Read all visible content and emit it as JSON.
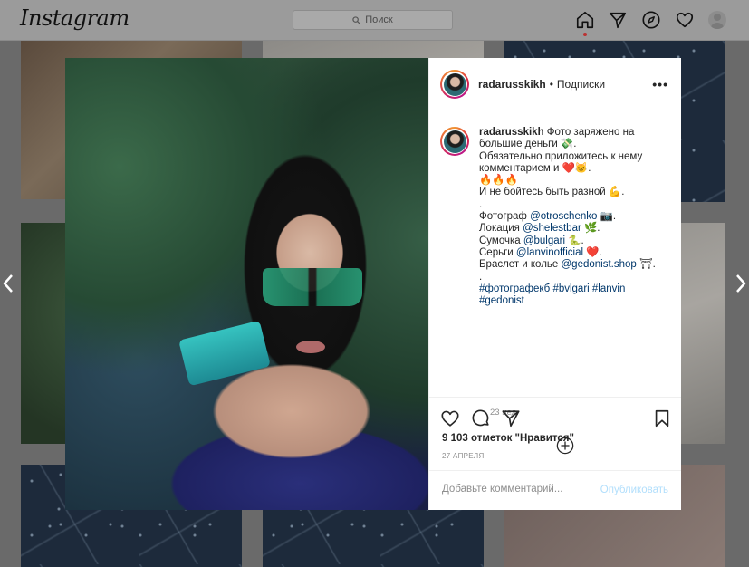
{
  "topbar": {
    "logo": "Instagram",
    "search_placeholder": "Поиск",
    "icons": [
      "home-icon",
      "direct-icon",
      "explore-icon",
      "activity-icon",
      "profile-avatar"
    ]
  },
  "post": {
    "username": "radarusskikh",
    "separator": "•",
    "follow_status": "Подписки",
    "more": "•••",
    "caption": {
      "author": "radarusskikh",
      "line1_text": " Фото заряжено на",
      "line2": "большие деньги 💸.",
      "line3": "Обязательно приложитесь к нему",
      "line4": "комментарием и ❤️🐱.",
      "line5": "🔥🔥🔥",
      "line6": "И не бойтесь быть разной 💪.",
      "line7": ".",
      "line8_prefix": "Фотограф ",
      "line8_tag": "@otroschenko",
      "line8_suffix": " 📷.",
      "line9_prefix": "Локация ",
      "line9_tag": "@shelestbar",
      "line9_suffix": " 🌿.",
      "line10_prefix": "Сумочка ",
      "line10_tag": "@bulgari",
      "line10_suffix": " 🐍.",
      "line11_prefix": "Серьги ",
      "line11_tag": "@lanvinofficial",
      "line11_suffix": " ❤️.",
      "line12_prefix": "Браслет и колье ",
      "line12_tag": "@gedonist.shop",
      "line12_suffix": " ⛩.",
      "line13": ".",
      "hashtags_line1": "#фотографекб #bvlgari #lanvin",
      "hashtags_line2": "#gedonist"
    },
    "time_ago": "23 нед.",
    "likes": "9 103 отметок \"Нравится\"",
    "date": "27 АПРЕЛЯ",
    "comment_placeholder": "Добавьте комментарий...",
    "publish_label": "Опубликовать"
  },
  "colors": {
    "link": "#00376b",
    "publish_disabled": "#b2dffc",
    "muted": "#8e8e8e"
  }
}
